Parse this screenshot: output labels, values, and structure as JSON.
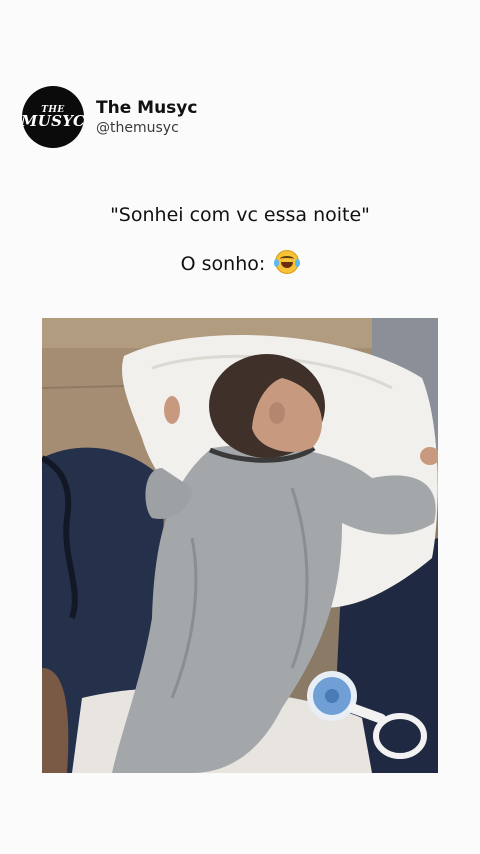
{
  "post": {
    "author": {
      "display_name": "The Musyc",
      "handle": "@themusyc",
      "avatar_text_line1": "THE",
      "avatar_text_line2": "MUSYC"
    },
    "quote_text": "\"Sonhei com vc essa noite\"",
    "caption_text": "O sonho:",
    "caption_emoji_icon": "face-with-tears-of-joy-icon"
  },
  "colors": {
    "background": "#fbfbfb",
    "avatar_bg": "#0b0b0b",
    "text": "#111111"
  }
}
